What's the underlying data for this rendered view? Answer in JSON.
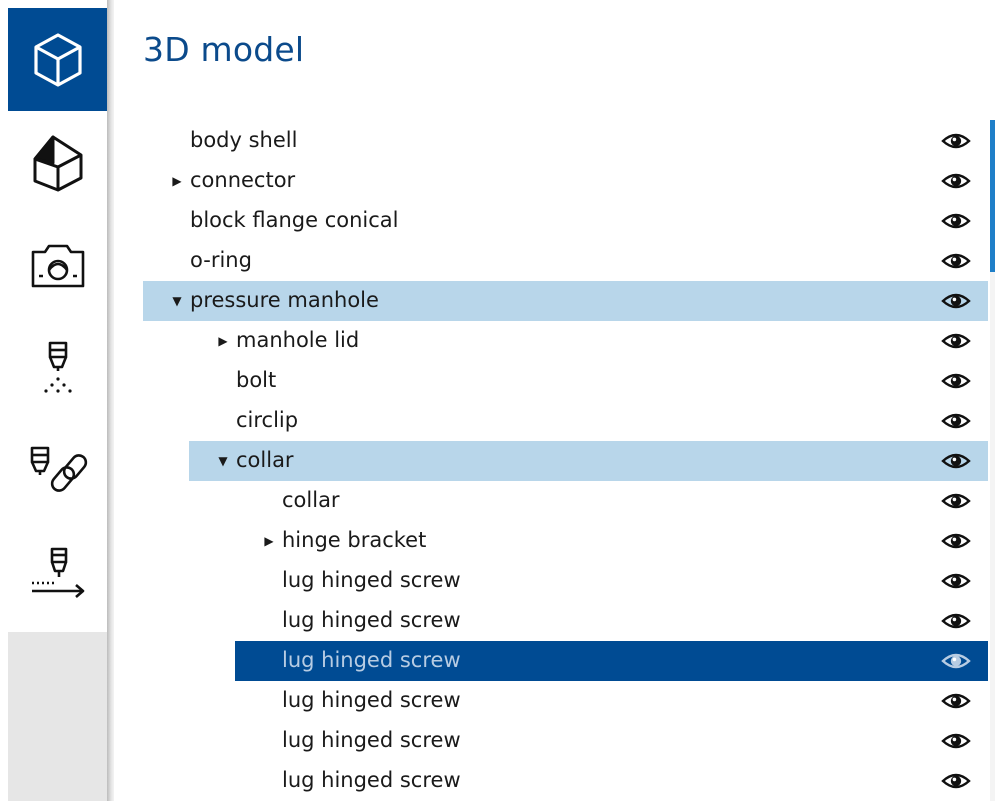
{
  "title": "3D model",
  "rail": {
    "items": [
      {
        "icon": "cube-icon",
        "active": true
      },
      {
        "icon": "solid-view-icon",
        "active": false
      },
      {
        "icon": "camera-icon",
        "active": false
      },
      {
        "icon": "spray-nozzle-icon",
        "active": false
      },
      {
        "icon": "nozzle-link-icon",
        "active": false
      },
      {
        "icon": "nozzle-path-icon",
        "active": false
      }
    ]
  },
  "tree": {
    "items": [
      {
        "label": "body shell",
        "level": 0,
        "caret": ""
      },
      {
        "label": "connector",
        "level": 0,
        "caret": "▶"
      },
      {
        "label": "block flange conical",
        "level": 0,
        "caret": ""
      },
      {
        "label": "o-ring",
        "level": 0,
        "caret": ""
      },
      {
        "label": "pressure manhole",
        "level": 0,
        "caret": "▼",
        "state": "highlighted"
      },
      {
        "label": "manhole lid",
        "level": 1,
        "caret": "▶"
      },
      {
        "label": "bolt",
        "level": 1,
        "caret": ""
      },
      {
        "label": "circlip",
        "level": 1,
        "caret": ""
      },
      {
        "label": "collar",
        "level": 1,
        "caret": "▼",
        "state": "highlighted"
      },
      {
        "label": "collar",
        "level": 2,
        "caret": ""
      },
      {
        "label": "hinge bracket",
        "level": 2,
        "caret": "▶"
      },
      {
        "label": "lug hinged screw",
        "level": 2,
        "caret": ""
      },
      {
        "label": "lug hinged screw",
        "level": 2,
        "caret": ""
      },
      {
        "label": "lug hinged screw",
        "level": 2,
        "caret": "",
        "state": "selected"
      },
      {
        "label": "lug hinged screw",
        "level": 2,
        "caret": ""
      },
      {
        "label": "lug hinged screw",
        "level": 2,
        "caret": ""
      },
      {
        "label": "lug hinged screw",
        "level": 2,
        "caret": ""
      }
    ]
  },
  "colors": {
    "accent": "#004b93",
    "title": "#0b4a8b",
    "highlight": "#b8d6ea",
    "selected_text": "#b7cce3",
    "scrollbar": "#1f7fc8"
  }
}
